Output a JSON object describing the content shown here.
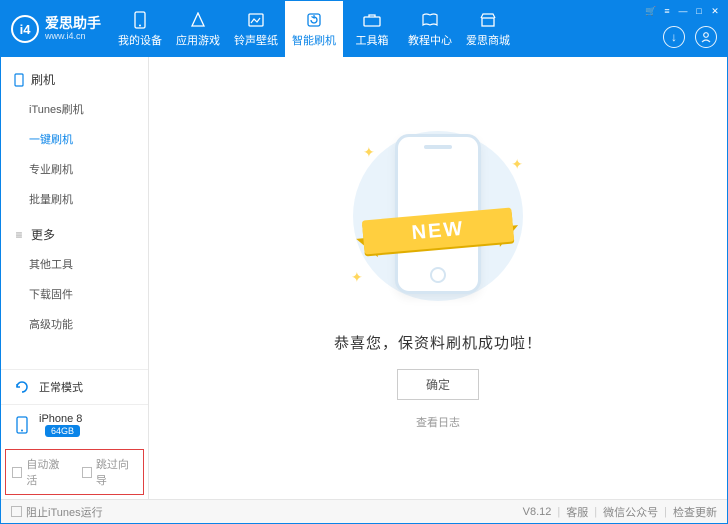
{
  "brand": {
    "name": "爱思助手",
    "url": "www.i4.cn",
    "logo_text": "i4"
  },
  "nav": {
    "items": [
      {
        "label": "我的设备"
      },
      {
        "label": "应用游戏"
      },
      {
        "label": "铃声壁纸"
      },
      {
        "label": "智能刷机"
      },
      {
        "label": "工具箱"
      },
      {
        "label": "教程中心"
      },
      {
        "label": "爱思商城"
      }
    ],
    "active_index": 3
  },
  "sidebar": {
    "sections": [
      {
        "title": "刷机",
        "items": [
          "iTunes刷机",
          "一键刷机",
          "专业刷机",
          "批量刷机"
        ],
        "active_index": 1
      },
      {
        "title": "更多",
        "items": [
          "其他工具",
          "下载固件",
          "高级功能"
        ],
        "active_index": -1
      }
    ],
    "mode_panel": {
      "label": "正常模式"
    },
    "device_panel": {
      "model": "iPhone 8",
      "capacity": "64GB"
    },
    "checks": {
      "auto_activate": "自动激活",
      "skip_wizard": "跳过向导"
    }
  },
  "content": {
    "ribbon_text": "NEW",
    "message": "恭喜您，保资料刷机成功啦！",
    "confirm_label": "确定",
    "view_log_label": "查看日志"
  },
  "statusbar": {
    "block_itunes": "阻止iTunes运行",
    "version": "V8.12",
    "support": "客服",
    "wechat": "微信公众号",
    "update": "检查更新"
  }
}
